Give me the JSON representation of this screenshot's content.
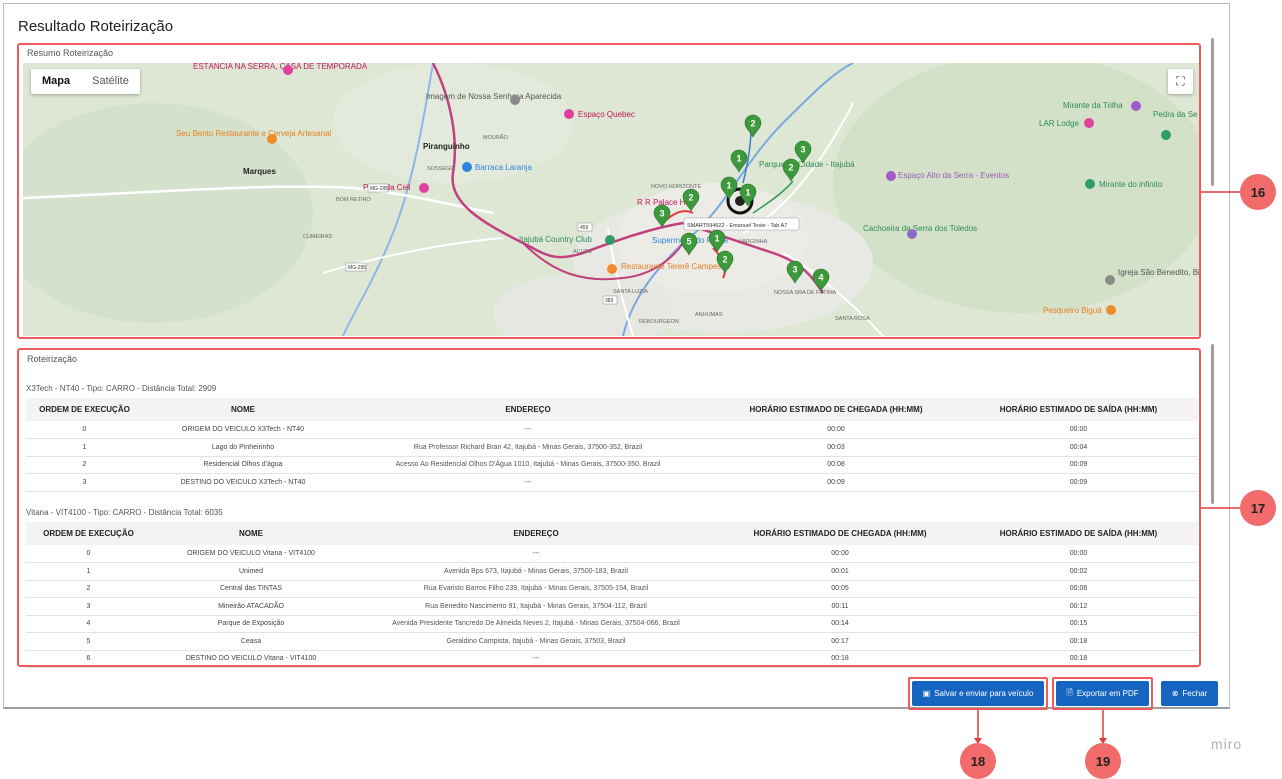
{
  "modal": {
    "title": "Resultado Roteirização"
  },
  "map_section": {
    "label": "Resumo Roteirização",
    "map_type_map": "Mapa",
    "map_type_satellite": "Satélite",
    "places": [
      "ESTÂNCIA NA SERRA, CASA DE TEMPORADA",
      "Imagem de Nossa Senhora Aparecida",
      "Espaço Quebec",
      "Seu Bento Restaurante e Cerveja Artesanal",
      "Piranguinho",
      "Marques",
      "Barraca Laranja",
      "Pousada Celi",
      "Itajubá Country Club",
      "Restaurante Tererê Campestre",
      "R R Palace H",
      "Supermercado Padre",
      "Parque da Cidade - Itajubá",
      "Espaço Alto da Serra - Eventos",
      "Cachoeira da Serra dos Toledos",
      "Mirante da Trilha",
      "LAR Lodge",
      "Pedra da Se",
      "Mirante do infinito",
      "Igreja São Benedito, Biguá",
      "Pesqueiro Biguá",
      "Rodovia Lourenço Martins Costa"
    ],
    "districts": [
      "MOURÃO",
      "SOSSEGO",
      "BOM RETIRO",
      "CUMEIRAS",
      "NOVO HORIZONTE",
      "VARGINHA",
      "AÇUDE",
      "SANTA LUZIA",
      "REBOURGEON",
      "ANHUMAS",
      "NOSSA SRA DE FÁTIMA",
      "SANTA ROSA"
    ],
    "roads": [
      "MG-295",
      "MG-295",
      "459",
      "383",
      "MGC-383"
    ],
    "tooltip": "SMART594622 - Emanuel Teste - Tab A7",
    "markers": [
      "2",
      "1",
      "3",
      "2",
      "1",
      "1",
      "2",
      "3",
      "5",
      "1",
      "2",
      "3",
      "4"
    ]
  },
  "routing_section": {
    "label": "Roteirização",
    "headers": [
      "ORDEM DE EXECUÇÃO",
      "NOME",
      "ENDEREÇO",
      "HORÁRIO ESTIMADO DE CHEGADA (HH:MM)",
      "HORÁRIO ESTIMADO DE SAÍDA (HH:MM)"
    ],
    "groups": [
      {
        "title": "X3Tech - NT40 - Tipo: CARRO - Distância Total: 2909",
        "rows": [
          [
            "0",
            "ORIGEM DO VEICULO X3Tech - NT40",
            "---",
            "00:00",
            "00:00"
          ],
          [
            "1",
            "Lago do Pinheirinho",
            "Rua Professor Richard Bran 42, Itajubá - Minas Gerais, 37500-352, Brazil",
            "00:03",
            "00:04"
          ],
          [
            "2",
            "Residencial Olhos d'água",
            "Acesso Ao Residencial Olhos D'Água 1010, Itajubá - Minas Gerais, 37500-350, Brazil",
            "00:08",
            "00:09"
          ],
          [
            "3",
            "DESTINO DO VEICULO X3Tech - NT40",
            "---",
            "00:09",
            "00:09"
          ]
        ]
      },
      {
        "title": "Vitana - VIT4100 - Tipo: CARRO - Distância Total: 6035",
        "rows": [
          [
            "0",
            "ORIGEM DO VEICULO Vitana - VIT4100",
            "---",
            "00:00",
            "00:00"
          ],
          [
            "1",
            "Unimed",
            "Avenida Bps 673, Itajubá - Minas Gerais, 37500-183, Brazil",
            "00:01",
            "00:02"
          ],
          [
            "2",
            "Central das TINTAS",
            "Rua Evaristo Barros Filho 239, Itajubá - Minas Gerais, 37505-154, Brazil",
            "00:05",
            "00:06"
          ],
          [
            "3",
            "Mineirão ATACADÃO",
            "Rua Benedito Nascimento 91, Itajubá - Minas Gerais, 37504-112, Brazil",
            "00:11",
            "00:12"
          ],
          [
            "4",
            "Parque de Exposição",
            "Avenida Presidente Tancredo De Almeida Neves 2, Itajubá - Minas Gerais, 37504-066, Brazil",
            "00:14",
            "00:15"
          ],
          [
            "5",
            "Ceasa",
            "Geraldino Campista, Itajubá - Minas Gerais, 37503, Brazil",
            "00:17",
            "00:18"
          ],
          [
            "6",
            "DESTINO DO VEICULO Vitana - VIT4100",
            "---",
            "00:18",
            "00:18"
          ]
        ]
      }
    ]
  },
  "actions": {
    "save_send": "Salvar e enviar para veículo",
    "export_pdf": "Exportar em PDF",
    "close": "Fechar"
  },
  "annotations": {
    "a16": "16",
    "a17": "17",
    "a18": "18",
    "a19": "19"
  },
  "watermark": "miro",
  "colors": {
    "primary": "#1565c0",
    "highlight": "#ef5b5b",
    "badge": "#f26b6b",
    "marker": "#3c9a3c",
    "route": "#c2407c"
  }
}
